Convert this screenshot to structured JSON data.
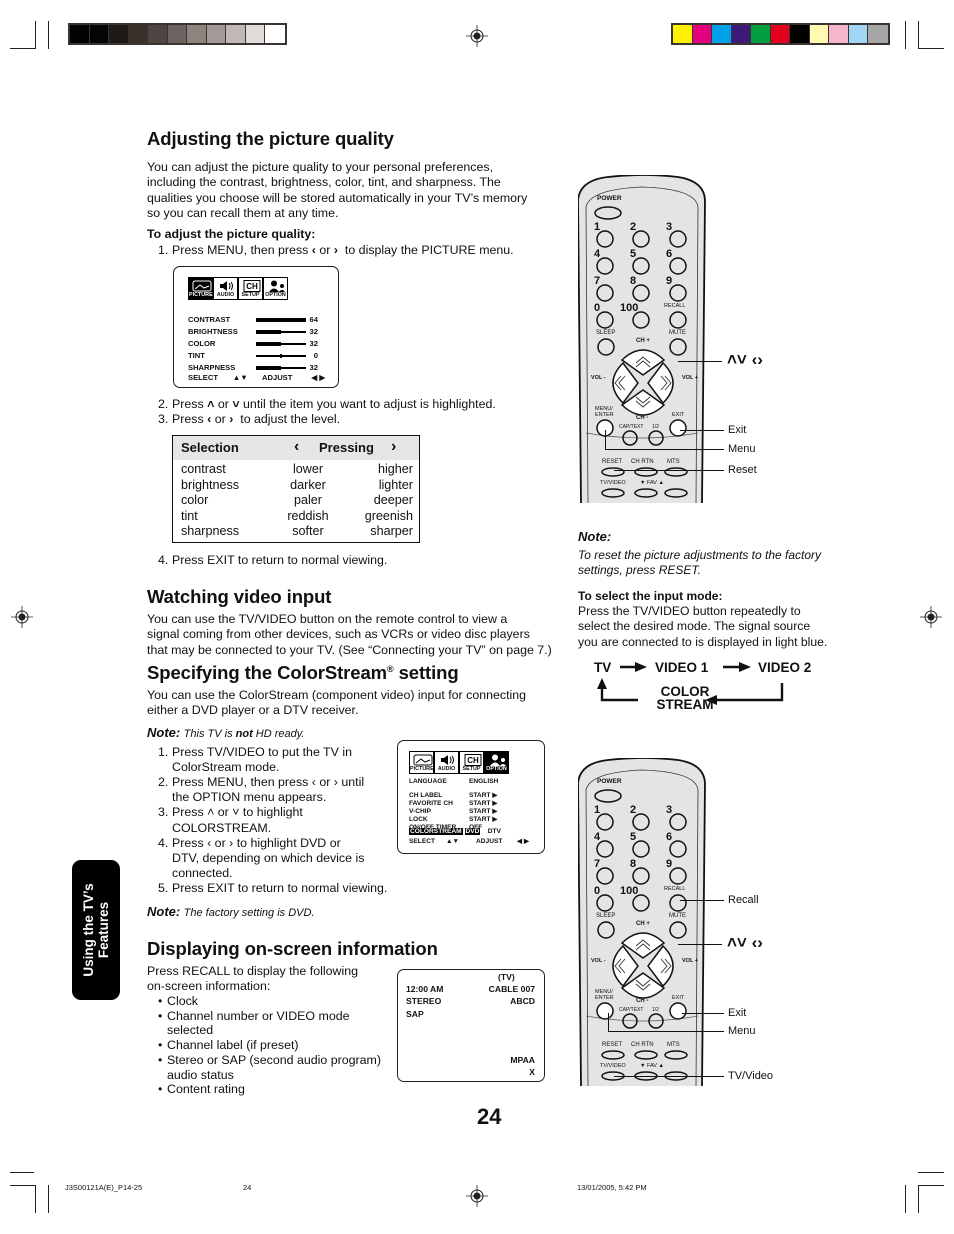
{
  "print_marks": {
    "gray_strip": [
      "#020202",
      "#050505",
      "#1d1a17",
      "#3a2f2b",
      "#4e4642",
      "#6b6460",
      "#8d8480",
      "#a39a97",
      "#c2b9b6",
      "#e0dcda",
      "#ffffff"
    ],
    "color_strip": [
      "#fff200",
      "#e4007f",
      "#00a0e9",
      "#3d1a78",
      "#009e3f",
      "#e60020",
      "#000000",
      "#fff9b1",
      "#f7b5cc",
      "#a0d6f4",
      "#a6a6a6"
    ]
  },
  "section_tab": {
    "line1": "Using the TV’s",
    "line2": "Features"
  },
  "picture_quality": {
    "title": "Adjusting the picture quality",
    "intro": [
      "You can adjust the picture quality to your personal preferences,",
      "including the contrast, brightness, color, tint, and sharpness. The",
      "qualities you choose will be stored automatically in your TV’s memory",
      "so you can recall them at any time."
    ],
    "howto_label": "To adjust the picture quality:",
    "steps": [
      {
        "n": "1.",
        "pre": "Press MENU, then press",
        "mid": "or",
        "post": "to display the PICTURE menu."
      },
      {
        "n": "2.",
        "pre": "Press",
        "mid": "or",
        "post": "until the item you want to adjust is highlighted."
      },
      {
        "n": "3.",
        "pre": "Press",
        "mid": "or",
        "post": "to adjust the level."
      },
      {
        "n": "4.",
        "text": "Press EXIT to return to normal viewing."
      }
    ],
    "osd": {
      "tabs": [
        "PICTURE",
        "AUDIO",
        "SETUP",
        "OPTION"
      ],
      "active_tab": "PICTURE",
      "items": [
        {
          "label": "CONTRAST",
          "value": "64",
          "level": 1.0,
          "type": "bar"
        },
        {
          "label": "BRIGHTNESS",
          "value": "32",
          "level": 0.5,
          "type": "bar"
        },
        {
          "label": "COLOR",
          "value": "32",
          "level": 0.5,
          "type": "bar"
        },
        {
          "label": "TINT",
          "value": "0",
          "level": 0.5,
          "type": "center"
        },
        {
          "label": "SHARPNESS",
          "value": "32",
          "level": 0.5,
          "type": "bar"
        }
      ],
      "select_label": "SELECT",
      "select_arrows": "▲▼",
      "adjust_label": "ADJUST",
      "adjust_arrows": "◀ ▶"
    },
    "table": {
      "col1": "Selection",
      "col2": "Pressing",
      "left_arrow": "‹",
      "right_arrow": "›",
      "rows": [
        {
          "item": "contrast",
          "left": "lower",
          "right": "higher"
        },
        {
          "item": "brightness",
          "left": "darker",
          "right": "lighter"
        },
        {
          "item": "color",
          "left": "paler",
          "right": "deeper"
        },
        {
          "item": "tint",
          "left": "reddish",
          "right": "greenish"
        },
        {
          "item": "sharpness",
          "left": "softer",
          "right": "sharper"
        }
      ]
    }
  },
  "video_input": {
    "title": "Watching video input",
    "body": [
      "You can use the TV/VIDEO button on the remote control to view a",
      "signal coming from other devices, such as VCRs or video disc players",
      "that may be connected to your TV. (See “Connecting your TV” on page 7.)"
    ]
  },
  "colorstream": {
    "title_pre": "Specifying the ColorStream",
    "title_reg": "®",
    "title_post": " setting",
    "body": [
      "You can use the ColorStream (component video) input for connecting",
      "either a DVD player or a DTV receiver."
    ],
    "note1_label": "Note:",
    "note1_pre": "This TV is ",
    "note1_bold": "not",
    "note1_post": " HD ready.",
    "steps": [
      {
        "n": "1.",
        "lines": [
          "Press TV/VIDEO to put the TV in",
          "ColorStream mode."
        ]
      },
      {
        "n": "2.",
        "lines": [
          "Press MENU, then press ‹ or › until",
          "the OPTION menu appears."
        ]
      },
      {
        "n": "3.",
        "lines": [
          "Press ˄ or ˅ to highlight",
          "COLORSTREAM."
        ]
      },
      {
        "n": "4.",
        "lines": [
          "Press ‹ or › to highlight DVD or",
          "DTV, depending on which device is",
          "connected."
        ]
      },
      {
        "n": "5.",
        "lines": [
          "Press EXIT to return to normal viewing."
        ]
      }
    ],
    "note2_label": "Note:",
    "note2_text": "The factory setting is DVD.",
    "osd": {
      "tabs": [
        "PICTURE",
        "AUDIO",
        "SETUP",
        "OPTION"
      ],
      "active_tab": "OPTION",
      "rows": [
        {
          "label": "LANGUAGE",
          "value": "ENGLISH"
        },
        {
          "label": "CH LABEL",
          "value": "START ▶"
        },
        {
          "label": "FAVORITE CH",
          "value": "START ▶"
        },
        {
          "label": "V-CHIP",
          "value": "START ▶"
        },
        {
          "label": "LOCK",
          "value": "START ▶"
        },
        {
          "label": "ON/OFF TIMER",
          "value": "OFF"
        }
      ],
      "highlight_label": "COLORSTREAM",
      "highlight_value": "DVD",
      "alt_value": "DTV",
      "select_label": "SELECT",
      "select_arrows": "▲▼",
      "adjust_label": "ADJUST",
      "adjust_arrows": "◀ ▶"
    }
  },
  "onscreen_info": {
    "title": "Displaying on-screen information",
    "intro": [
      "Press RECALL to display the following",
      "on-screen information:"
    ],
    "bullets": [
      [
        "Clock"
      ],
      [
        "Channel number or VIDEO mode",
        "selected"
      ],
      [
        "Channel label (if preset)"
      ],
      [
        "Stereo or SAP (second audio program)",
        "audio status"
      ],
      [
        "Content rating"
      ]
    ],
    "osd": {
      "source": "(TV)",
      "time": "12:00 AM",
      "channel": "CABLE  007",
      "audio1": "STEREO",
      "label": "ABCD",
      "audio2": "SAP",
      "rating_label": "MPAA",
      "rating": "X"
    }
  },
  "side_notes": {
    "note_label": "Note:",
    "note_text": [
      "To reset the picture adjustments to the factory",
      "settings, press RESET."
    ],
    "input_label": "To select the input mode:",
    "input_text": [
      "Press the TV/VIDEO button repeatedly to",
      "select the desired mode. The signal source",
      "you are connected to is displayed in light blue."
    ],
    "flow": {
      "tv": "TV",
      "video1": "VIDEO 1",
      "video2": "VIDEO 2",
      "colorstream_1": "COLOR",
      "colorstream_2": "STREAM"
    }
  },
  "remote": {
    "power": "POWER",
    "digits": [
      "1",
      "2",
      "3",
      "4",
      "5",
      "6",
      "7",
      "8",
      "9",
      "0",
      "100"
    ],
    "recall": "RECALL",
    "sleep": "SLEEP",
    "mute": "MUTE",
    "ch_plus": "CH +",
    "ch_minus": "CH -",
    "vol_minus": "VOL -",
    "vol_plus": "VOL +",
    "menu_enter_1": "MENU/",
    "menu_enter_2": "ENTER",
    "exit": "EXIT",
    "cap_text": "CAP/TEXT",
    "half": "1/2",
    "reset": "RESET",
    "ch_rtn": "CH RTN",
    "mts": "MTS",
    "tv_video": "TV/VIDEO",
    "fav": "▼  FAV  ▲"
  },
  "remote1_callouts": {
    "arrows": "˄˅ ‹›",
    "exit": "Exit",
    "menu": "Menu",
    "reset": "Reset"
  },
  "remote2_callouts": {
    "recall": "Recall",
    "arrows": "˄˅ ‹›",
    "exit": "Exit",
    "menu": "Menu",
    "tv_video": "TV/Video"
  },
  "page_number": "24",
  "footer": {
    "file": "J3S00121A(E)_P14-25",
    "page": "24",
    "timestamp": "13/01/2005, 5:42 PM"
  }
}
